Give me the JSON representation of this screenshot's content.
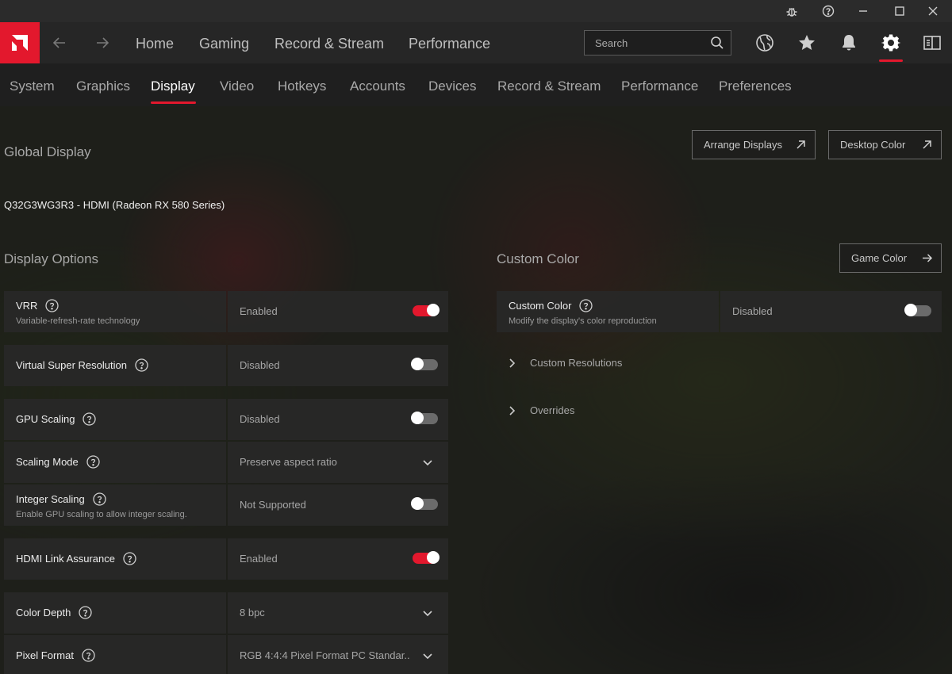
{
  "window": {
    "titlebar_icons": [
      "bug-icon",
      "help-icon",
      "minimize-icon",
      "maximize-icon",
      "close-icon"
    ]
  },
  "main_nav": {
    "items": [
      "Home",
      "Gaming",
      "Record & Stream",
      "Performance"
    ],
    "search_placeholder": "Search"
  },
  "sub_nav": {
    "items": [
      "System",
      "Graphics",
      "Display",
      "Video",
      "Hotkeys",
      "Accounts",
      "Devices",
      "Record & Stream",
      "Performance",
      "Preferences"
    ],
    "active": "Display"
  },
  "global_display": {
    "title": "Global Display",
    "monitor": "Q32G3WG3R3 - HDMI (Radeon RX 580 Series)",
    "arrange_displays": "Arrange Displays",
    "desktop_color": "Desktop Color"
  },
  "display_options": {
    "title": "Display Options",
    "vrr": {
      "label": "VRR",
      "sub": "Variable-refresh-rate technology",
      "value": "Enabled"
    },
    "vsr": {
      "label": "Virtual Super Resolution",
      "value": "Disabled"
    },
    "gpu_scaling": {
      "label": "GPU Scaling",
      "value": "Disabled"
    },
    "scaling_mode": {
      "label": "Scaling Mode",
      "value": "Preserve aspect ratio"
    },
    "integer_scaling": {
      "label": "Integer Scaling",
      "sub": "Enable GPU scaling to allow integer scaling.",
      "value": "Not Supported"
    },
    "hdmi_link": {
      "label": "HDMI Link Assurance",
      "value": "Enabled"
    },
    "color_depth": {
      "label": "Color Depth",
      "value": "8 bpc"
    },
    "pixel_format": {
      "label": "Pixel Format",
      "value": "RGB 4:4:4 Pixel Format PC Standar..."
    }
  },
  "custom_color": {
    "title": "Custom Color",
    "game_color": "Game Color",
    "toggle": {
      "label": "Custom Color",
      "sub": "Modify the display's color reproduction",
      "value": "Disabled"
    },
    "custom_resolutions": "Custom Resolutions",
    "overrides": "Overrides"
  },
  "colors": {
    "accent": "#e3182d",
    "panel": "#282828"
  }
}
